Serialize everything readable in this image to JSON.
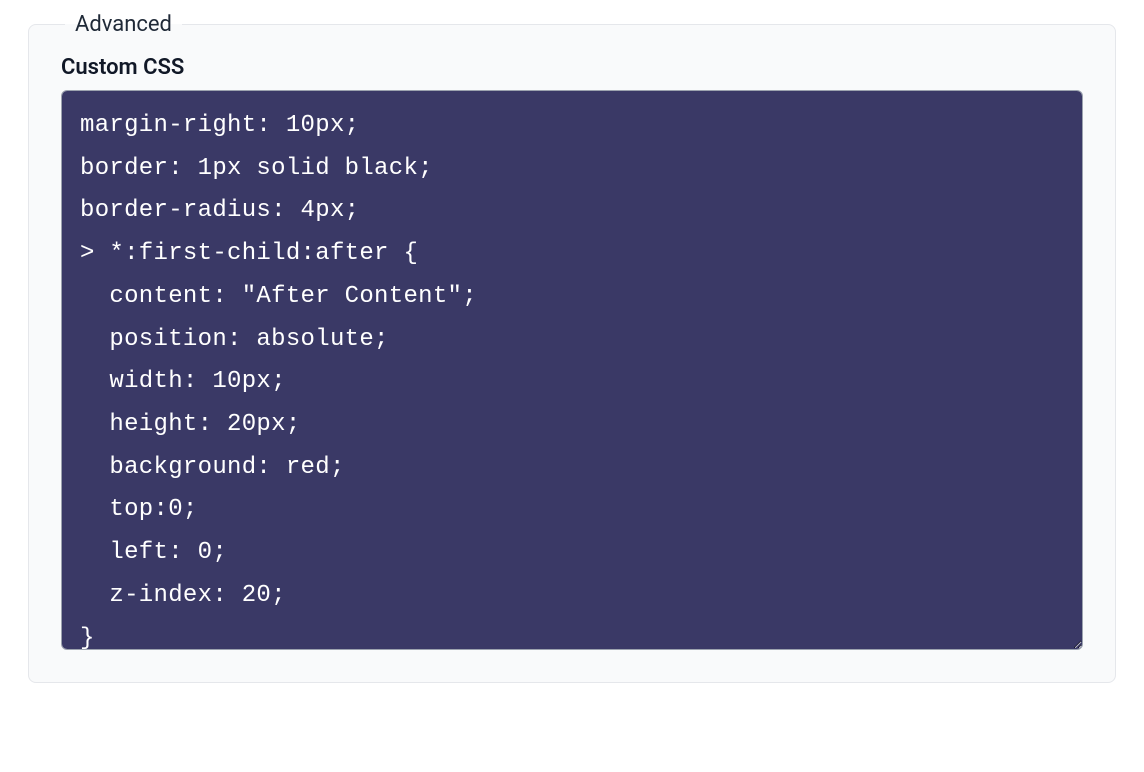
{
  "section": {
    "legend": "Advanced",
    "field_label": "Custom CSS",
    "css_value": "margin-right: 10px;\nborder: 1px solid black;\nborder-radius: 4px;\n> *:first-child:after {\n  content: \"After Content\";\n  position: absolute;\n  width: 10px;\n  height: 20px;\n  background: red;\n  top:0;\n  left: 0;\n  z-index: 20;\n}"
  },
  "colors": {
    "editor_bg": "#3a3966",
    "editor_fg": "#ffffff",
    "panel_bg": "#f9fafb",
    "border": "#e5e7eb"
  }
}
